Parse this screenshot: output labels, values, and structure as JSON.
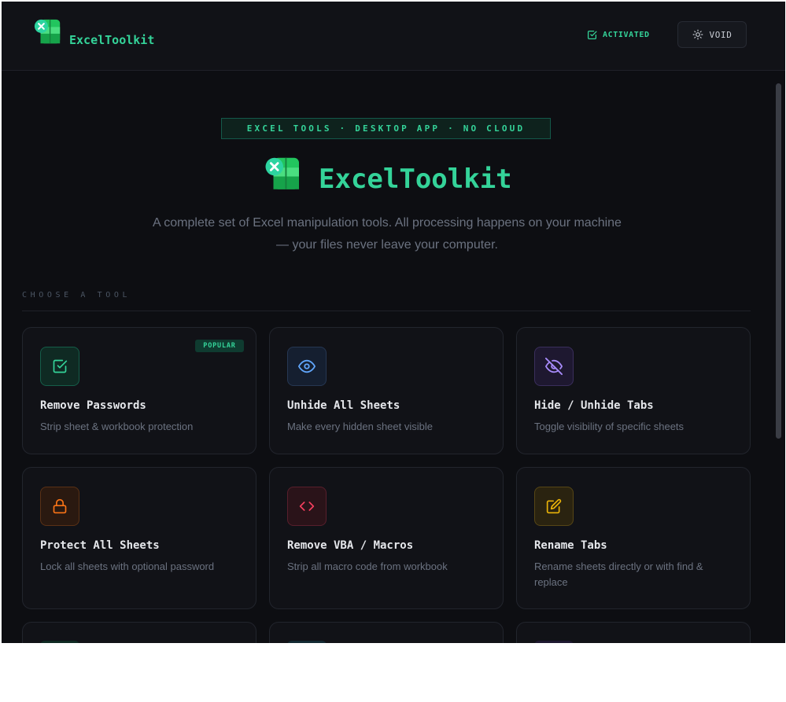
{
  "header": {
    "brand_name": "ExcelToolkit",
    "status_label": "ACTIVATED",
    "theme_button_label": "VOID"
  },
  "hero": {
    "badge": "EXCEL TOOLS · DESKTOP APP · NO CLOUD",
    "title": "ExcelToolkit",
    "description": "A complete set of Excel manipulation tools. All processing happens on your machine — your files never leave your computer."
  },
  "tools_section": {
    "label": "CHOOSE A TOOL",
    "cards": [
      {
        "title": "Remove Passwords",
        "description": "Strip sheet & workbook protection",
        "badge": "POPULAR",
        "icon": "check-square-icon"
      },
      {
        "title": "Unhide All Sheets",
        "description": "Make every hidden sheet visible",
        "icon": "eye-icon"
      },
      {
        "title": "Hide / Unhide Tabs",
        "description": "Toggle visibility of specific sheets",
        "icon": "eye-off-icon"
      },
      {
        "title": "Protect All Sheets",
        "description": "Lock all sheets with optional password",
        "icon": "lock-icon"
      },
      {
        "title": "Remove VBA / Macros",
        "description": "Strip all macro code from workbook",
        "icon": "code-icon"
      },
      {
        "title": "Rename Tabs",
        "description": "Rename sheets directly or with find & replace",
        "icon": "edit-icon"
      }
    ]
  },
  "colors": {
    "accent": "#34d399",
    "background": "#0d0e12",
    "card_background": "#111217"
  }
}
